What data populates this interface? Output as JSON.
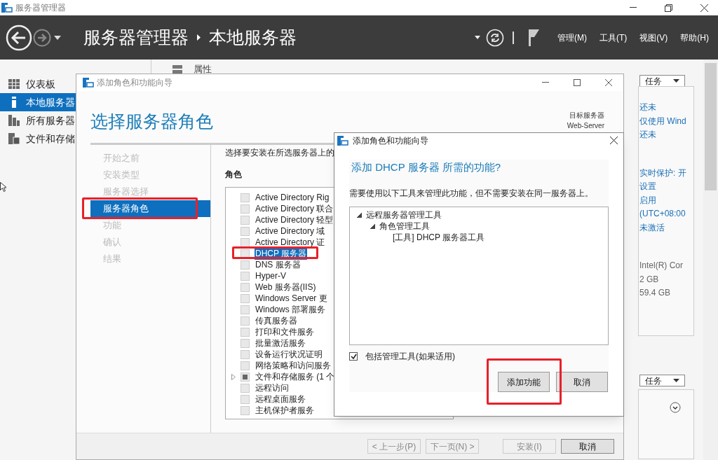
{
  "app": {
    "title": "服务器管理器",
    "breadcrumb": [
      "服务器管理器",
      "本地服务器"
    ],
    "menus": [
      "管理(M)",
      "工具(T)",
      "视图(V)",
      "帮助(H)"
    ]
  },
  "sidebar": {
    "items": [
      {
        "label": "仪表板",
        "selected": false
      },
      {
        "label": "本地服务器",
        "selected": true
      },
      {
        "label": "所有服务器",
        "selected": false
      },
      {
        "label": "文件和存储",
        "selected": false
      }
    ]
  },
  "properties": {
    "title": "属性"
  },
  "right_panel": {
    "tasks_button": "任务",
    "groups": [
      {
        "kind": "link",
        "lines": [
          "还未",
          "仅使用 Wind",
          "还未"
        ]
      },
      {
        "kind": "link",
        "lines": [
          "实时保护: 开",
          "设置",
          "启用",
          "(UTC+08:00",
          "未激活"
        ]
      },
      {
        "kind": "plain",
        "lines": [
          "Intel(R) Cor",
          "2 GB",
          "59.4 GB"
        ]
      }
    ],
    "tasks_button_2": "任务"
  },
  "wizard": {
    "title": "添加角色和功能向导",
    "heading": "选择服务器角色",
    "target_label": "目标服务器",
    "target_server": "Web-Server",
    "steps": [
      {
        "label": "开始之前",
        "selected": false
      },
      {
        "label": "安装类型",
        "selected": false
      },
      {
        "label": "服务器选择",
        "selected": false
      },
      {
        "label": "服务器角色",
        "selected": true
      },
      {
        "label": "功能",
        "selected": false
      },
      {
        "label": "确认",
        "selected": false
      },
      {
        "label": "结果",
        "selected": false
      }
    ],
    "description": "选择要安装在所选服务器上的",
    "roles_label": "角色",
    "roles": [
      {
        "label": "Active Directory Rig",
        "checked": false,
        "indeterminate": false,
        "expandable": false,
        "selected": false
      },
      {
        "label": "Active Directory 联合",
        "checked": false,
        "indeterminate": false,
        "expandable": false,
        "selected": false
      },
      {
        "label": "Active Directory 轻型",
        "checked": false,
        "indeterminate": false,
        "expandable": false,
        "selected": false
      },
      {
        "label": "Active Directory 域",
        "checked": false,
        "indeterminate": false,
        "expandable": false,
        "selected": false
      },
      {
        "label": "Active Directory 证",
        "checked": false,
        "indeterminate": false,
        "expandable": false,
        "selected": false
      },
      {
        "label": "DHCP 服务器",
        "checked": false,
        "indeterminate": false,
        "expandable": false,
        "selected": true
      },
      {
        "label": "DNS 服务器",
        "checked": false,
        "indeterminate": false,
        "expandable": false,
        "selected": false
      },
      {
        "label": "Hyper-V",
        "checked": false,
        "indeterminate": false,
        "expandable": false,
        "selected": false
      },
      {
        "label": "Web 服务器(IIS)",
        "checked": false,
        "indeterminate": false,
        "expandable": false,
        "selected": false
      },
      {
        "label": "Windows Server 更",
        "checked": false,
        "indeterminate": false,
        "expandable": false,
        "selected": false
      },
      {
        "label": "Windows 部署服务",
        "checked": false,
        "indeterminate": false,
        "expandable": false,
        "selected": false
      },
      {
        "label": "传真服务器",
        "checked": false,
        "indeterminate": false,
        "expandable": false,
        "selected": false
      },
      {
        "label": "打印和文件服务",
        "checked": false,
        "indeterminate": false,
        "expandable": false,
        "selected": false
      },
      {
        "label": "批量激活服务",
        "checked": false,
        "indeterminate": false,
        "expandable": false,
        "selected": false
      },
      {
        "label": "设备运行状况证明",
        "checked": false,
        "indeterminate": false,
        "expandable": false,
        "selected": false
      },
      {
        "label": "网络策略和访问服务",
        "checked": false,
        "indeterminate": false,
        "expandable": false,
        "selected": false
      },
      {
        "label": "文件和存储服务 (1 个",
        "checked": false,
        "indeterminate": true,
        "expandable": true,
        "selected": false
      },
      {
        "label": "远程访问",
        "checked": false,
        "indeterminate": false,
        "expandable": false,
        "selected": false
      },
      {
        "label": "远程桌面服务",
        "checked": false,
        "indeterminate": false,
        "expandable": false,
        "selected": false
      },
      {
        "label": "主机保护者服务",
        "checked": false,
        "indeterminate": false,
        "expandable": false,
        "selected": false
      }
    ],
    "buttons": [
      {
        "label": "< 上一步(P)",
        "disabled": true
      },
      {
        "label": "下一页(N) >",
        "disabled": true
      },
      {
        "label": "安装(I)",
        "disabled": true
      },
      {
        "label": "取消",
        "disabled": false
      }
    ]
  },
  "dialog": {
    "title": "添加角色和功能向导",
    "heading": "添加 DHCP 服务器 所需的功能?",
    "message": "需要使用以下工具来管理此功能，但不需要安装在同一服务器上。",
    "tree": [
      {
        "label": "远程服务器管理工具",
        "expanded": true,
        "children": [
          {
            "label": "角色管理工具",
            "expanded": true,
            "children": [
              {
                "label": "[工具] DHCP 服务器工具"
              }
            ]
          }
        ]
      }
    ],
    "include_tools": {
      "label": "包括管理工具(如果适用)",
      "checked": true
    },
    "buttons": [
      {
        "label": "添加功能"
      },
      {
        "label": "取消"
      }
    ]
  }
}
